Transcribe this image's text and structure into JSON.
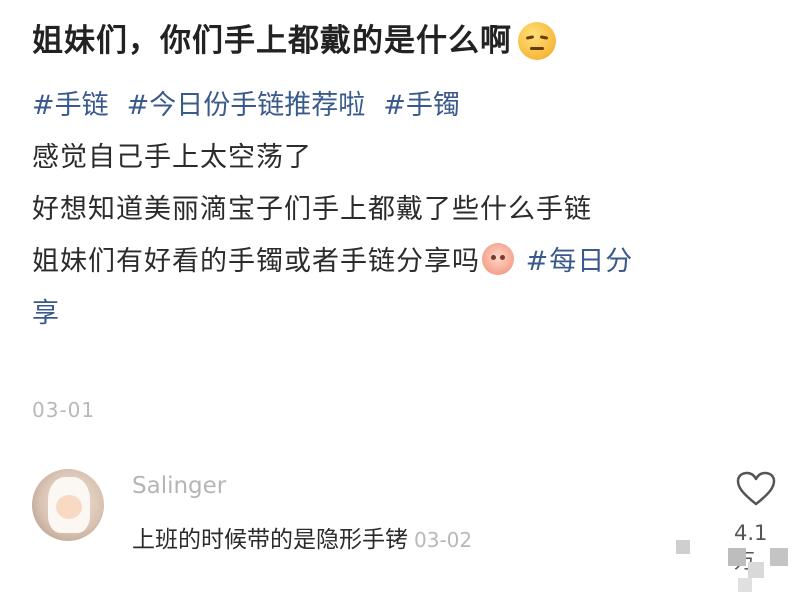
{
  "post": {
    "title": "姐妹们，你们手上都戴的是什么啊",
    "title_emoji": "smirk-emoji-icon",
    "tags": [
      "#手链",
      "#今日份手链推荐啦",
      "#手镯"
    ],
    "body_lines": [
      "感觉自己手上太空荡了",
      "好想知道美丽滴宝子们手上都戴了些什么手链",
      "姐妹们有好看的手镯或者手链分享吗"
    ],
    "inline_emoji": "peach-face-emoji-icon",
    "inline_tag": "#每日分",
    "last_line": "享",
    "date": "03-01"
  },
  "comment": {
    "username": "Salinger",
    "text": "上班的时候带的是隐形手铐",
    "date": "03-02",
    "like_icon": "heart-outline-icon",
    "like_count": "4.1万"
  },
  "colors": {
    "tag": "#3a5a8c",
    "text": "#2b2b2b",
    "muted": "#b8b8b8"
  }
}
